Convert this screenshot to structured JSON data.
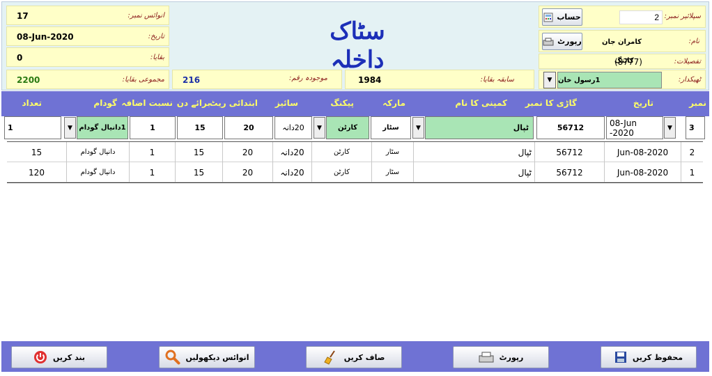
{
  "header": {
    "title": "سٹاک داخلہ",
    "invoice_label": "انوائس نمبر:",
    "invoice_no": "17",
    "date_label": "تاریخ:",
    "date": "08-Jun-2020",
    "balance_label": "بقایا:",
    "balance": "0",
    "total_balance_label": "مجموعی بقایا:",
    "total_balance": "2200",
    "current_amount_label": "موجودہ رقم:",
    "current_amount": "216",
    "previous_balance_label": "سابقہ بقایا:",
    "previous_balance": "1984",
    "supplier_no_label": "سپلائیر نمبر:",
    "supplier_no": "2",
    "account_button": "حساب",
    "name_label": "نام:",
    "name": "کامران جان",
    "report_button": "رپورٹ",
    "details_label": "تفصیلات:",
    "details_line1": "کاٹنگ",
    "details_line2": "(8777)",
    "contractor_label": "ٹھیکدار:",
    "contractor": "1رسول خان"
  },
  "columns": [
    "نمبر",
    "تاریخ",
    "گاڑی کا نمبر",
    "کمپنی کا نام",
    "مارکہ",
    "پیکنگ",
    "سائیز",
    "ابتدائی ریٹ",
    "برائے دن",
    "نسبت اضافہ",
    "گودام",
    "تعداد"
  ],
  "entry": {
    "no": "3",
    "date": "08-Jun -2020",
    "vehicle": "56712",
    "company": "ٹپال",
    "brand": "سٹار",
    "packing": "کارٹن",
    "size": "20دانہ",
    "rate": "20",
    "days": "15",
    "increase": "1",
    "warehouse": "1دانیال گودام",
    "quantity": "1"
  },
  "rows": [
    {
      "no": "2",
      "date": "Jun-08-2020",
      "vehicle": "56712",
      "company": "ٹپال",
      "brand": "سٹار",
      "packing": "کارٹن",
      "size": "20دانہ",
      "rate": "20",
      "days": "15",
      "increase": "1",
      "warehouse": "دانیال گودام",
      "quantity": "15"
    },
    {
      "no": "1",
      "date": "Jun-08-2020",
      "vehicle": "56712",
      "company": "ٹپال",
      "brand": "سٹار",
      "packing": "کارٹن",
      "size": "20دانہ",
      "rate": "20",
      "days": "15",
      "increase": "1",
      "warehouse": "دانیال گودام",
      "quantity": "120"
    }
  ],
  "footer": {
    "save": "محفوظ کریں",
    "report": "رپورٹ",
    "clear": "صاف کریں",
    "view_invoice": "انوائس دیکھولیں",
    "close": "بند کریں"
  },
  "colors": {
    "header_bar": "#6f72d4",
    "header_text": "#ffff66",
    "green_field": "#a9e5b5",
    "yellow_box": "#ffffc8"
  }
}
